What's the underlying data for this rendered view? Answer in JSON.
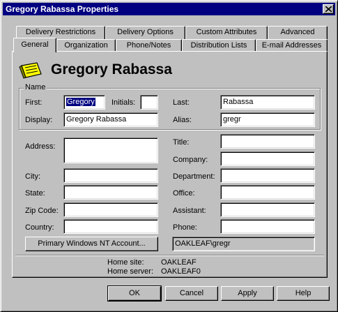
{
  "window": {
    "title": "Gregory Rabassa Properties",
    "close_label": "×"
  },
  "tabs_back": [
    "Delivery Restrictions",
    "Delivery Options",
    "Custom Attributes",
    "Advanced"
  ],
  "tabs_front": [
    "General",
    "Organization",
    "Phone/Notes",
    "Distribution Lists",
    "E-mail Addresses"
  ],
  "header": {
    "display_name": "Gregory Rabassa",
    "icon": "mailbox-icon"
  },
  "name_group": {
    "title": "Name",
    "first_label": "First:",
    "first_value": "Gregory",
    "initials_label": "Initials:",
    "initials_value": "",
    "last_label": "Last:",
    "last_value": "Rabassa",
    "display_label": "Display:",
    "display_value": "Gregory Rabassa",
    "alias_label": "Alias:",
    "alias_value": "gregr"
  },
  "address": {
    "address_label": "Address:",
    "address_value": "",
    "city_label": "City:",
    "city_value": "",
    "state_label": "State:",
    "state_value": "",
    "zip_label": "Zip Code:",
    "zip_value": "",
    "country_label": "Country:",
    "country_value": ""
  },
  "business": {
    "title_label": "Title:",
    "title_value": "",
    "company_label": "Company:",
    "company_value": "",
    "department_label": "Department:",
    "department_value": "",
    "office_label": "Office:",
    "office_value": "",
    "assistant_label": "Assistant:",
    "assistant_value": "",
    "phone_label": "Phone:",
    "phone_value": ""
  },
  "nt_account": {
    "button_label": "Primary Windows NT Account...",
    "value": "OAKLEAF\\gregr"
  },
  "site": {
    "home_site_label": "Home site:",
    "home_site_value": "OAKLEAF",
    "home_server_label": "Home server:",
    "home_server_value": "OAKLEAF0"
  },
  "buttons": {
    "ok": "OK",
    "cancel": "Cancel",
    "apply": "Apply",
    "help": "Help"
  },
  "colors": {
    "face": "#c0c0c0",
    "titlebar": "#000080",
    "selection": "#000080"
  }
}
